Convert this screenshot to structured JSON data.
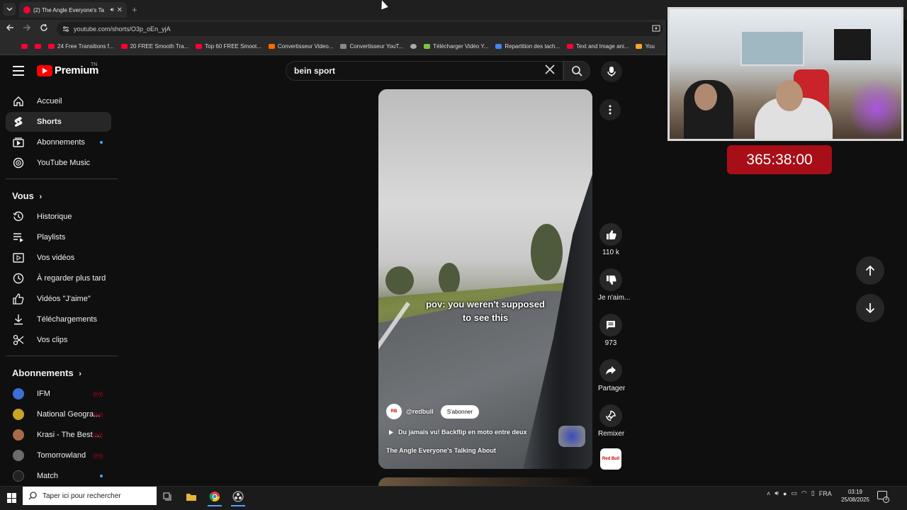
{
  "browser": {
    "tab_title": "(2) The Angle Everyone's Ta",
    "new_tab": "+",
    "tab_close": "✕",
    "url": "youtube.com/shorts/O3p_oEn_yjA",
    "bookmarks": [
      {
        "label": "",
        "icon": "youtube-icon"
      },
      {
        "label": "",
        "icon": "youtube-icon"
      },
      {
        "label": "24 Free Transitions f...",
        "icon": "youtube-icon"
      },
      {
        "label": "20 FREE Smooth Tra...",
        "icon": "youtube-icon"
      },
      {
        "label": "Top 60 FREE Smoot...",
        "icon": "youtube-icon"
      },
      {
        "label": "Convertisseur Video...",
        "icon": "z-icon"
      },
      {
        "label": "Convertisseur YouT...",
        "icon": "converter-icon"
      },
      {
        "label": "",
        "icon": "globe-icon"
      },
      {
        "label": "Télécharger Vidéo Y...",
        "icon": "download-icon"
      },
      {
        "label": "Repartition des tach...",
        "icon": "docs-icon"
      },
      {
        "label": "Text and Image ani...",
        "icon": "youtube-icon"
      },
      {
        "label": "You",
        "icon": "spark-icon"
      }
    ]
  },
  "youtube": {
    "logo_text": "Premium",
    "logo_sup": "TN",
    "search_query": "bein sport",
    "sidebar": {
      "main": [
        {
          "label": "Accueil",
          "icon": "home-icon"
        },
        {
          "label": "Shorts",
          "icon": "shorts-icon",
          "active": true
        },
        {
          "label": "Abonnements",
          "icon": "subscriptions-icon",
          "dot": true
        },
        {
          "label": "YouTube Music",
          "icon": "music-icon"
        }
      ],
      "you_heading": "Vous",
      "you": [
        {
          "label": "Historique",
          "icon": "history-icon"
        },
        {
          "label": "Playlists",
          "icon": "playlist-icon"
        },
        {
          "label": "Vos vidéos",
          "icon": "videos-icon"
        },
        {
          "label": "À regarder plus tard",
          "icon": "clock-icon"
        },
        {
          "label": "Vidéos \"J'aime\"",
          "icon": "like-icon"
        },
        {
          "label": "Téléchargements",
          "icon": "download-icon"
        },
        {
          "label": "Vos clips",
          "icon": "scissors-icon"
        }
      ],
      "subs_heading": "Abonnements",
      "subs": [
        {
          "label": "IFM",
          "live": "((•))",
          "color": "#3a6fd8"
        },
        {
          "label": "National Geogra...",
          "live": "((•))",
          "color": "#c9a227"
        },
        {
          "label": "Krasi - The Best ...",
          "live": "((•))",
          "color": "#a86b4a"
        },
        {
          "label": "Tomorrowland",
          "live": "((•))",
          "color": "#6b6b6b"
        },
        {
          "label": "Match",
          "dot": true,
          "color": "#222222"
        }
      ]
    },
    "short": {
      "subtitle_line1": "pov: you weren't supposed",
      "subtitle_line2": "to see this",
      "channel": "@redbull",
      "subscribe_label": "S'abonner",
      "related_video": "Du jamais vu! Backflip en moto entre deux",
      "title": "The Angle Everyone's Talking About"
    },
    "actions": {
      "likes": "110 k",
      "dislike_label": "Je n'aim...",
      "comments": "973",
      "share_label": "Partager",
      "remix_label": "Remixer",
      "channel_badge": "Red Bull"
    }
  },
  "overlay": {
    "timer": "365:38:00"
  },
  "taskbar": {
    "search_placeholder": "Taper ici pour rechercher",
    "language": "FRA",
    "time": "03:19",
    "date": "25/08/2025",
    "notification_count": "3"
  }
}
